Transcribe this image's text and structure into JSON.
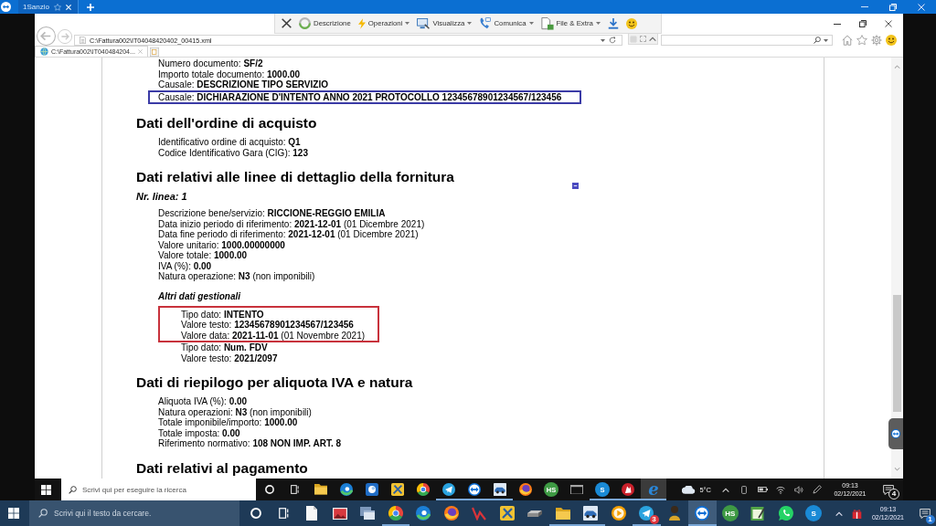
{
  "session_bar": {
    "tabs": [
      {
        "label": "1Sanzio",
        "selected": true
      }
    ]
  },
  "session_toolbar": {
    "items": [
      {
        "kind": "close"
      },
      {
        "kind": "info",
        "label": "Descrizione",
        "menu": false
      },
      {
        "kind": "actions",
        "label": "Operazioni",
        "menu": true
      },
      {
        "kind": "view",
        "label": "Visualizza",
        "menu": true
      },
      {
        "kind": "call",
        "label": "Comunica",
        "menu": true
      },
      {
        "kind": "files",
        "label": "File & Extra",
        "menu": true
      },
      {
        "kind": "download"
      },
      {
        "kind": "smiley"
      }
    ]
  },
  "browser": {
    "address": "C:\\Fattura002\\IT04048420402_00415.xml",
    "tabs": [
      {
        "label": "C:\\Fattura002\\IT040484204...",
        "selected": true
      }
    ]
  },
  "document": {
    "intro": {
      "groups": [
        {
          "boxed": false,
          "rows": [
            "Numero documento: **SF/2**",
            "Importo totale documento: **1000.00**",
            "Causale: **DESCRIZIONE TIPO SERVIZIO**"
          ]
        },
        {
          "boxed": true,
          "color": "#3b3ba6",
          "rows": [
            "Causale: **DICHIARAZIONE D'INTENTO ANNO 2021 PROTOCOLLO 12345678901234567/123456**"
          ]
        }
      ]
    },
    "sections": [
      {
        "heading": "Dati dell'ordine di acquisto",
        "collapsible": false,
        "groups": [
          {
            "boxed": false,
            "rows": [
              "Identificativo ordine di acquisto: **Q1**",
              "Codice Identificativo Gara (CIG): **123**"
            ]
          }
        ]
      },
      {
        "heading": "Dati relativi alle linee di dettaglio della fornitura",
        "collapsible": true,
        "lines": [
          {
            "title": "Nr. linea: 1",
            "groups": [
              {
                "boxed": false,
                "rows": [
                  "Descrizione bene/servizio: **RICCIONE-REGGIO EMILIA**",
                  "Data inizio periodo di riferimento: **2021-12-01** (01 Dicembre 2021)",
                  "Data fine periodo di riferimento: **2021-12-01** (01 Dicembre 2021)",
                  "Valore unitario: **1000.00000000**",
                  "Valore totale: **1000.00**",
                  "IVA (%): **0.00**",
                  "Natura operazione: **N3** (non imponibili)"
                ]
              }
            ],
            "subsections": [
              {
                "title": "Altri dati gestionali",
                "groups": [
                  {
                    "boxed": true,
                    "color": "#c8323c",
                    "rows": [
                      "Tipo dato: **INTENTO**",
                      "Valore testo: **12345678901234567/123456**",
                      "Valore data: **2021-11-01** (01 Novembre 2021)"
                    ]
                  },
                  {
                    "boxed": false,
                    "rows": [
                      "Tipo dato: **Num. FDV**",
                      "Valore testo: **2021/2097**"
                    ]
                  }
                ]
              }
            ]
          }
        ]
      },
      {
        "heading": "Dati di riepilogo per aliquota IVA e natura",
        "collapsible": false,
        "groups": [
          {
            "boxed": false,
            "rows": [
              "Aliquota IVA (%): **0.00**",
              "Natura operazioni: **N3** (non imponibili)",
              "Totale imponibile/importo: **1000.00**",
              "Totale imposta: **0.00**",
              "Riferimento normativo: **108 NON IMP. ART. 8**"
            ]
          }
        ]
      },
      {
        "heading": "Dati relativi al pagamento",
        "collapsible": false
      }
    ]
  },
  "remote_taskbar": {
    "search": {
      "placeholder": "Scrivi qui per eseguire la ricerca"
    },
    "apps": [
      {
        "kind": "folder",
        "running": false,
        "selected": false
      },
      {
        "kind": "swirl",
        "running": false,
        "selected": false
      },
      {
        "kind": "tile",
        "running": false,
        "selected": false
      },
      {
        "kind": "tools",
        "running": false,
        "selected": false
      },
      {
        "kind": "segmented",
        "running": false,
        "selected": false
      },
      {
        "kind": "plane",
        "running": true,
        "selected": false
      },
      {
        "kind": "arrows",
        "running": true,
        "selected": false
      },
      {
        "kind": "car",
        "running": true,
        "selected": false
      },
      {
        "kind": "flame",
        "running": false,
        "selected": false
      },
      {
        "kind": "letter",
        "glyph": "HS",
        "color": "#3e9a44",
        "running": false,
        "selected": false
      },
      {
        "kind": "window",
        "running": false,
        "selected": false
      },
      {
        "kind": "letter",
        "glyph": "S",
        "color": "#1a8ad6",
        "running": true,
        "selected": false
      },
      {
        "kind": "emblem",
        "running": true,
        "selected": false
      },
      {
        "kind": "glyph",
        "glyph": "e",
        "color": "#2a86d8",
        "running": true,
        "selected": true
      }
    ],
    "weather": "5°C",
    "time": "09:13",
    "date": "02/12/2021",
    "notifications": "4"
  },
  "local_taskbar": {
    "search": {
      "placeholder": "Scrivi qui il testo da cercare."
    },
    "apps": [
      {
        "kind": "document",
        "running": false,
        "selected": false
      },
      {
        "kind": "picture",
        "running": false,
        "selected": false
      },
      {
        "kind": "stack",
        "running": false,
        "selected": false
      },
      {
        "kind": "segmented",
        "running": true,
        "selected": false
      },
      {
        "kind": "swirl",
        "running": false,
        "selected": false
      },
      {
        "kind": "flame",
        "running": false,
        "selected": false
      },
      {
        "kind": "zigzag",
        "running": false,
        "selected": false
      },
      {
        "kind": "tools",
        "running": false,
        "selected": false
      },
      {
        "kind": "drive",
        "running": false,
        "selected": false
      },
      {
        "kind": "folder",
        "running": true,
        "selected": false
      },
      {
        "kind": "car",
        "running": true,
        "selected": false
      },
      {
        "kind": "play",
        "running": false,
        "selected": false
      },
      {
        "kind": "plane",
        "running": true,
        "selected": false,
        "badge": "3"
      },
      {
        "kind": "figure",
        "running": false,
        "selected": false
      },
      {
        "kind": "arrows",
        "running": true,
        "selected": true
      },
      {
        "kind": "letter",
        "glyph": "HS",
        "color": "#3e9a44",
        "running": false,
        "selected": false
      },
      {
        "kind": "notepad",
        "running": false,
        "selected": false
      },
      {
        "kind": "chat",
        "running": false,
        "selected": false
      },
      {
        "kind": "letter",
        "glyph": "S",
        "color": "#1a8ad6",
        "running": false,
        "selected": false
      }
    ],
    "time": "09:13",
    "date": "02/12/2021",
    "notifications": "1"
  }
}
